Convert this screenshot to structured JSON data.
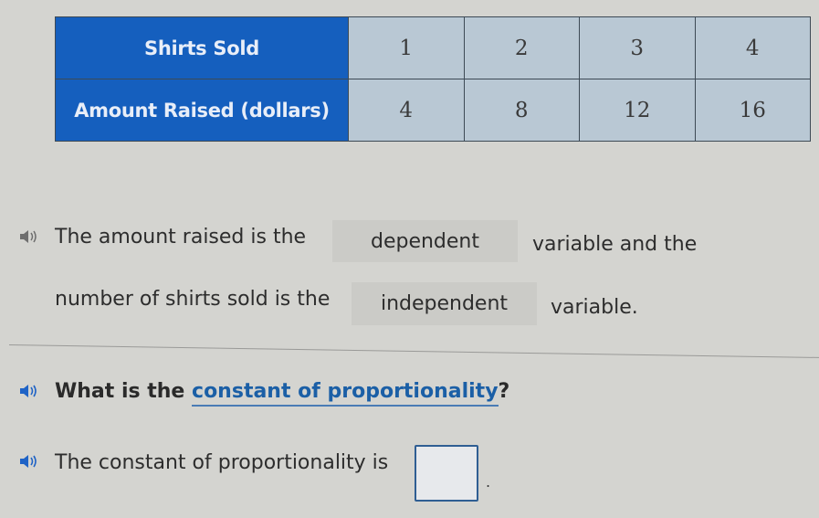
{
  "table": {
    "rows": [
      {
        "header": "Shirts Sold",
        "values": [
          "1",
          "2",
          "3",
          "4"
        ]
      },
      {
        "header": "Amount Raised (dollars)",
        "values": [
          "4",
          "8",
          "12",
          "16"
        ]
      }
    ]
  },
  "statement": {
    "part1": "The amount raised is the",
    "blank1": "dependent",
    "part2": "variable and the",
    "part3": "number of shirts sold is the",
    "blank2": "independent",
    "part4": "variable."
  },
  "question": {
    "prefix": "What is the",
    "term": "constant of proportionality",
    "suffix": "?"
  },
  "answer": {
    "prompt": "The constant of proportionality is",
    "value": "",
    "period": "."
  },
  "icons": {
    "speaker": "speaker-icon"
  },
  "colors": {
    "header_bg": "#155fbe",
    "cell_bg": "#b9c8d4",
    "link": "#1b5fa6",
    "speaker_active": "#1f63c6",
    "speaker_inactive": "#6e6e6e"
  }
}
